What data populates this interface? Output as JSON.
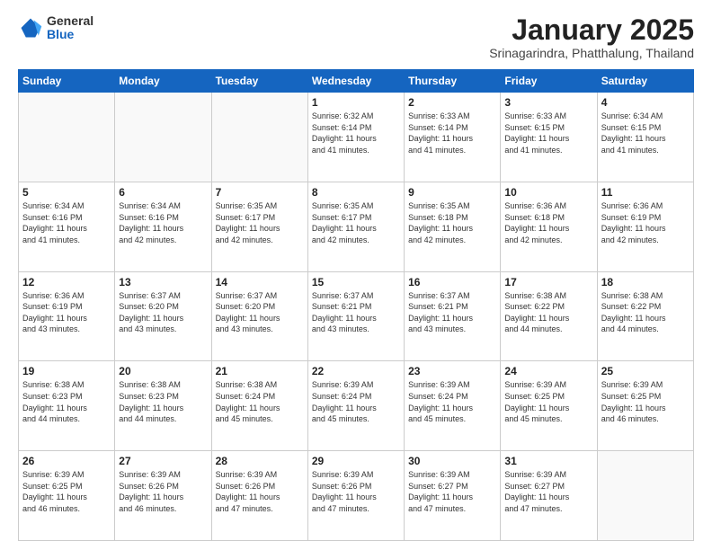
{
  "logo": {
    "general": "General",
    "blue": "Blue"
  },
  "title": {
    "month": "January 2025",
    "location": "Srinagarindra, Phatthalung, Thailand"
  },
  "days_of_week": [
    "Sunday",
    "Monday",
    "Tuesday",
    "Wednesday",
    "Thursday",
    "Friday",
    "Saturday"
  ],
  "weeks": [
    [
      {
        "day": null,
        "info": null
      },
      {
        "day": null,
        "info": null
      },
      {
        "day": null,
        "info": null
      },
      {
        "day": "1",
        "info": "Sunrise: 6:32 AM\nSunset: 6:14 PM\nDaylight: 11 hours\nand 41 minutes."
      },
      {
        "day": "2",
        "info": "Sunrise: 6:33 AM\nSunset: 6:14 PM\nDaylight: 11 hours\nand 41 minutes."
      },
      {
        "day": "3",
        "info": "Sunrise: 6:33 AM\nSunset: 6:15 PM\nDaylight: 11 hours\nand 41 minutes."
      },
      {
        "day": "4",
        "info": "Sunrise: 6:34 AM\nSunset: 6:15 PM\nDaylight: 11 hours\nand 41 minutes."
      }
    ],
    [
      {
        "day": "5",
        "info": "Sunrise: 6:34 AM\nSunset: 6:16 PM\nDaylight: 11 hours\nand 41 minutes."
      },
      {
        "day": "6",
        "info": "Sunrise: 6:34 AM\nSunset: 6:16 PM\nDaylight: 11 hours\nand 42 minutes."
      },
      {
        "day": "7",
        "info": "Sunrise: 6:35 AM\nSunset: 6:17 PM\nDaylight: 11 hours\nand 42 minutes."
      },
      {
        "day": "8",
        "info": "Sunrise: 6:35 AM\nSunset: 6:17 PM\nDaylight: 11 hours\nand 42 minutes."
      },
      {
        "day": "9",
        "info": "Sunrise: 6:35 AM\nSunset: 6:18 PM\nDaylight: 11 hours\nand 42 minutes."
      },
      {
        "day": "10",
        "info": "Sunrise: 6:36 AM\nSunset: 6:18 PM\nDaylight: 11 hours\nand 42 minutes."
      },
      {
        "day": "11",
        "info": "Sunrise: 6:36 AM\nSunset: 6:19 PM\nDaylight: 11 hours\nand 42 minutes."
      }
    ],
    [
      {
        "day": "12",
        "info": "Sunrise: 6:36 AM\nSunset: 6:19 PM\nDaylight: 11 hours\nand 43 minutes."
      },
      {
        "day": "13",
        "info": "Sunrise: 6:37 AM\nSunset: 6:20 PM\nDaylight: 11 hours\nand 43 minutes."
      },
      {
        "day": "14",
        "info": "Sunrise: 6:37 AM\nSunset: 6:20 PM\nDaylight: 11 hours\nand 43 minutes."
      },
      {
        "day": "15",
        "info": "Sunrise: 6:37 AM\nSunset: 6:21 PM\nDaylight: 11 hours\nand 43 minutes."
      },
      {
        "day": "16",
        "info": "Sunrise: 6:37 AM\nSunset: 6:21 PM\nDaylight: 11 hours\nand 43 minutes."
      },
      {
        "day": "17",
        "info": "Sunrise: 6:38 AM\nSunset: 6:22 PM\nDaylight: 11 hours\nand 44 minutes."
      },
      {
        "day": "18",
        "info": "Sunrise: 6:38 AM\nSunset: 6:22 PM\nDaylight: 11 hours\nand 44 minutes."
      }
    ],
    [
      {
        "day": "19",
        "info": "Sunrise: 6:38 AM\nSunset: 6:23 PM\nDaylight: 11 hours\nand 44 minutes."
      },
      {
        "day": "20",
        "info": "Sunrise: 6:38 AM\nSunset: 6:23 PM\nDaylight: 11 hours\nand 44 minutes."
      },
      {
        "day": "21",
        "info": "Sunrise: 6:38 AM\nSunset: 6:24 PM\nDaylight: 11 hours\nand 45 minutes."
      },
      {
        "day": "22",
        "info": "Sunrise: 6:39 AM\nSunset: 6:24 PM\nDaylight: 11 hours\nand 45 minutes."
      },
      {
        "day": "23",
        "info": "Sunrise: 6:39 AM\nSunset: 6:24 PM\nDaylight: 11 hours\nand 45 minutes."
      },
      {
        "day": "24",
        "info": "Sunrise: 6:39 AM\nSunset: 6:25 PM\nDaylight: 11 hours\nand 45 minutes."
      },
      {
        "day": "25",
        "info": "Sunrise: 6:39 AM\nSunset: 6:25 PM\nDaylight: 11 hours\nand 46 minutes."
      }
    ],
    [
      {
        "day": "26",
        "info": "Sunrise: 6:39 AM\nSunset: 6:25 PM\nDaylight: 11 hours\nand 46 minutes."
      },
      {
        "day": "27",
        "info": "Sunrise: 6:39 AM\nSunset: 6:26 PM\nDaylight: 11 hours\nand 46 minutes."
      },
      {
        "day": "28",
        "info": "Sunrise: 6:39 AM\nSunset: 6:26 PM\nDaylight: 11 hours\nand 47 minutes."
      },
      {
        "day": "29",
        "info": "Sunrise: 6:39 AM\nSunset: 6:26 PM\nDaylight: 11 hours\nand 47 minutes."
      },
      {
        "day": "30",
        "info": "Sunrise: 6:39 AM\nSunset: 6:27 PM\nDaylight: 11 hours\nand 47 minutes."
      },
      {
        "day": "31",
        "info": "Sunrise: 6:39 AM\nSunset: 6:27 PM\nDaylight: 11 hours\nand 47 minutes."
      },
      {
        "day": null,
        "info": null
      }
    ]
  ]
}
